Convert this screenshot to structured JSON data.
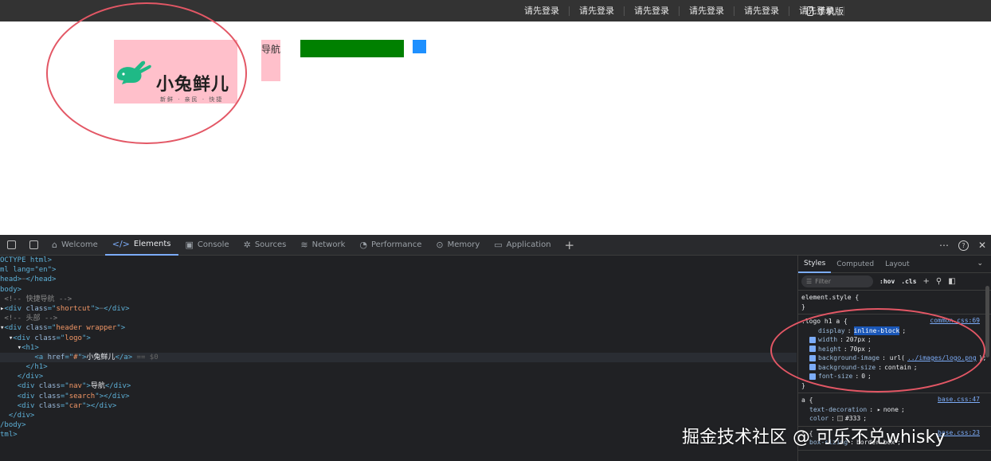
{
  "shortcut": {
    "links": [
      "请先登录",
      "请先登录",
      "请先登录",
      "请先登录",
      "请先登录",
      "请先登录"
    ],
    "mobile_label": "手机版"
  },
  "page": {
    "logo": {
      "name": "小兔鲜儿",
      "slogan": "新鲜 · 亲民 · 快捷",
      "brand_color": "#1fb986"
    },
    "nav_label": "导航",
    "colors": {
      "logo_bg": "#ffc0cb",
      "search_bg": "#008000",
      "car_bg": "#1e90ff",
      "annotation": "#e35765"
    }
  },
  "devtools": {
    "tabs": [
      {
        "label": "Welcome",
        "icon": "home-icon"
      },
      {
        "label": "Elements",
        "icon": "code-icon",
        "active": true
      },
      {
        "label": "Console",
        "icon": "console-icon"
      },
      {
        "label": "Sources",
        "icon": "bug-icon"
      },
      {
        "label": "Network",
        "icon": "wifi-icon"
      },
      {
        "label": "Performance",
        "icon": "gauge-icon"
      },
      {
        "label": "Memory",
        "icon": "chip-icon"
      },
      {
        "label": "Application",
        "icon": "window-icon"
      }
    ],
    "dom": {
      "doctype": "OCTYPE html>",
      "html_open": "ml lang=\"en\">",
      "head": "head>",
      "body": "body>",
      "comment_shortcut": "<!-- 快捷导航 -->",
      "comment_header": "<!-- 头部 -->",
      "shortcut_class": "shortcut",
      "header_class": "header wrapper",
      "logo_class": "logo",
      "a_href": "#",
      "a_text": "小兔鲜儿",
      "a_suffix": "== $0",
      "nav_class": "nav",
      "nav_text": "导航",
      "search_class": "search",
      "car_class": "car",
      "body_close": "/body>",
      "html_close": "tml>"
    },
    "styles": {
      "tabs": [
        "Styles",
        "Computed",
        "Layout"
      ],
      "filter_placeholder": "Filter",
      "hov": ":hov",
      "cls": ".cls",
      "element_style": "element.style {",
      "close_brace": "}",
      "rule1": {
        "selector": ".logo h1 a {",
        "source": "common.css:69",
        "display_prop": "display",
        "display_val": "inline-block",
        "width_prop": "width",
        "width_val": "207px",
        "height_prop": "height",
        "height_val": "70px",
        "bgimg_prop": "background-image",
        "bgimg_url": "../images/logo.png",
        "bgsize_prop": "background-size",
        "bgsize_val": "contain",
        "fontsize_prop": "font-size",
        "fontsize_val": "0"
      },
      "rule2": {
        "selector": "a {",
        "source": "base.css:47",
        "td_prop": "text-decoration",
        "td_val": "none",
        "color_prop": "color",
        "color_val": "#333"
      },
      "rule3": {
        "selector": "* {",
        "source": "base.css:23",
        "bs_prop": "box-sizing",
        "bs_val": "border-box"
      }
    }
  },
  "watermark": "掘金技术社区 @ 可乐不兑whisky"
}
